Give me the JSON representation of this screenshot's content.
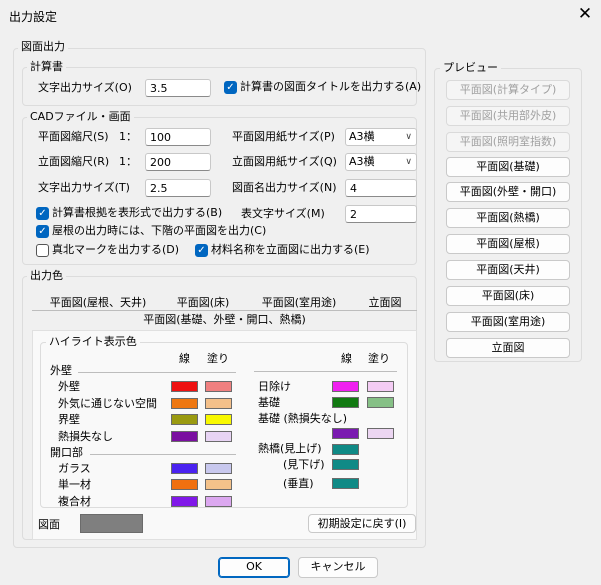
{
  "window": {
    "title": "出力設定"
  },
  "groups": {
    "main": "図面出力",
    "calc": "計算書",
    "cad": "CADファイル・画面",
    "color": "出力色",
    "preview": "プレビュー"
  },
  "calc": {
    "text_size_label": "文字出力サイズ(O)",
    "text_size_value": "3.5",
    "title_checkbox_label": "計算書の図面タイトルを出力する(A)"
  },
  "cad": {
    "plan_scale_label": "平面図縮尺(S)",
    "plan_scale_prefix": "1：",
    "plan_scale_value": "100",
    "elev_scale_label": "立面図縮尺(R)",
    "elev_scale_prefix": "1：",
    "elev_scale_value": "200",
    "text_size_label": "文字出力サイズ(T)",
    "text_size_value": "2.5",
    "plan_paper_label": "平面図用紙サイズ(P)",
    "plan_paper_value": "A3横",
    "elev_paper_label": "立面図用紙サイズ(Q)",
    "elev_paper_value": "A3横",
    "drawing_name_size_label": "図面名出力サイズ(N)",
    "drawing_name_size_value": "4",
    "table_text_size_label": "表文字サイズ(M)",
    "table_text_size_value": "2",
    "cb_table_basis": "計算書根拠を表形式で出力する(B)",
    "cb_roof_lower": "屋根の出力時には、下階の平面図を出力(C)",
    "cb_north_mark": "真北マークを出力する(D)",
    "cb_material_name": "材料名称を立面図に出力する(E)"
  },
  "tabs": {
    "row1": [
      "平面図(屋根、天井)",
      "平面図(床)",
      "平面図(室用途)",
      "立面図"
    ],
    "active": "平面図(基礎、外壁・開口、熱橋)"
  },
  "highlight": {
    "title": "ハイライト表示色",
    "col_line": "線",
    "col_fill": "塗り",
    "left": {
      "sec_wall": "外壁",
      "wall": "外壁",
      "non_outside": "外気に通じない空間",
      "boundary": "界壁",
      "no_heat_loss": "熱損失なし",
      "sec_opening": "開口部",
      "glass": "ガラス",
      "single": "単一材",
      "composite": "複合材"
    },
    "right": {
      "shade": "日除け",
      "foundation": "基礎",
      "foundation_no_loss": "基礎 (熱損失なし)",
      "bridge_up": "熱橋(見上げ)",
      "bridge_down": "(見下げ)",
      "bridge_vert": "(垂直)"
    },
    "drawing_label": "図面",
    "reset_button": "初期設定に戻す(I)"
  },
  "colors": {
    "wall_line": "#ee1111",
    "wall_fill": "#f08080",
    "nonout_line": "#ee7711",
    "nonout_fill": "#f4c08a",
    "boundary_line": "#9a9a10",
    "boundary_fill": "#f8f800",
    "noloss_line": "#7a0fa0",
    "noloss_fill": "#e8d4f4",
    "glass_line": "#4a22f0",
    "glass_fill": "#c8c8ee",
    "single_line": "#f07010",
    "single_fill": "#f4c28a",
    "composite_line": "#8018e8",
    "composite_fill": "#dca8f0",
    "shade_line": "#f020f0",
    "shade_fill": "#f4ccf4",
    "foundation_line": "#127a12",
    "foundation_fill": "#86c086",
    "fnoloss_line": "#7a1ab0",
    "fnoloss_fill": "#ecd6f2",
    "bridge_up_line": "#108a86",
    "bridge_down_line": "#108a86",
    "bridge_vert_line": "#108a86",
    "drawing": "#7f7f7f",
    "checkbox_accent": "#0066c0"
  },
  "preview": {
    "buttons": [
      {
        "label": "平面図(計算タイプ)",
        "enabled": false
      },
      {
        "label": "平面図(共用部外皮)",
        "enabled": false
      },
      {
        "label": "平面図(照明室指数)",
        "enabled": false
      },
      {
        "label": "平面図(基礎)",
        "enabled": true
      },
      {
        "label": "平面図(外壁・開口)",
        "enabled": true
      },
      {
        "label": "平面図(熱橋)",
        "enabled": true
      },
      {
        "label": "平面図(屋根)",
        "enabled": true
      },
      {
        "label": "平面図(天井)",
        "enabled": true
      },
      {
        "label": "平面図(床)",
        "enabled": true
      },
      {
        "label": "平面図(室用途)",
        "enabled": true
      },
      {
        "label": "立面図",
        "enabled": true
      }
    ]
  },
  "footer": {
    "ok": "OK",
    "cancel": "キャンセル"
  }
}
